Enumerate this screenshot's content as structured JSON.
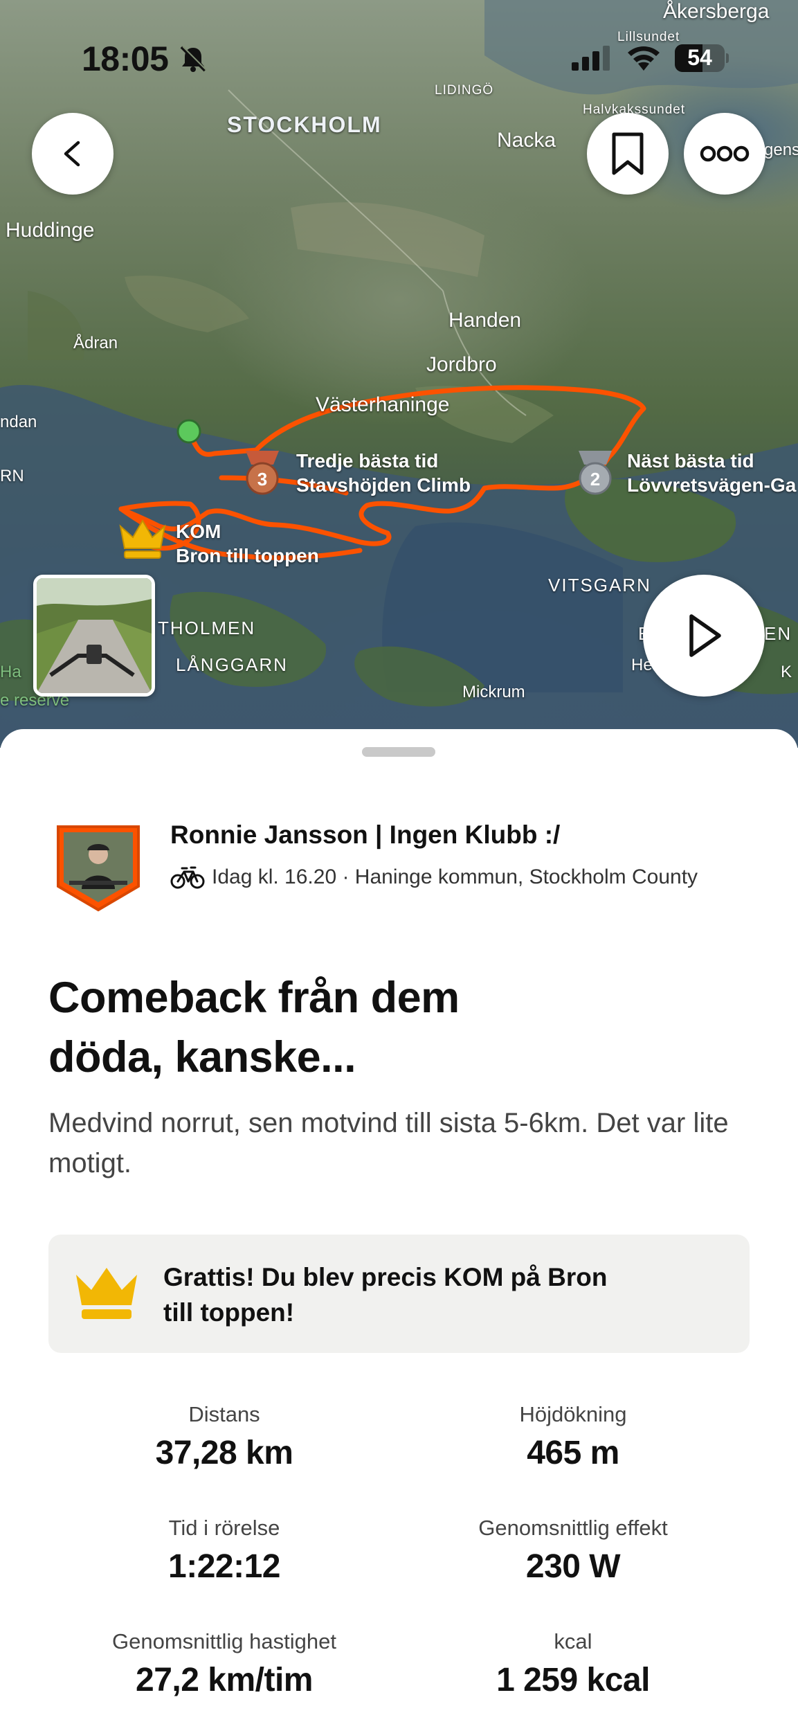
{
  "status_bar": {
    "time": "18:05",
    "battery": "54"
  },
  "map": {
    "labels": {
      "akersberga": "Åkersberga",
      "lillsundet": "Lillsundet",
      "lidingo": "LIDINGÖ",
      "stockholm": "STOCKHOLM",
      "nacka": "Nacka",
      "halvkakssundet": "Halvkakssundet",
      "gens": "gens",
      "huddinge": "Huddinge",
      "adran": "Ådran",
      "handen": "Handen",
      "jordbro": "Jordbro",
      "vasterhaninge": "Västerhaninge",
      "ndan": "ndan",
      "rn": "RN",
      "vitsgarn": "VITSGARN",
      "tholmen": "THOLMEN",
      "langgarn": "LÅNGGARN",
      "mickrum": "Mickrum",
      "ha": "Ha",
      "e_reserve": "e reserve",
      "en": "EN",
      "he": "He",
      "k": "K",
      "e": "E"
    },
    "segments": {
      "third": {
        "badge": "3",
        "line1": "Tredje bästa tid",
        "line2": "Stavshöjden Climb"
      },
      "second": {
        "badge": "2",
        "line1": "Näst bästa tid",
        "line2": "Lövvretsvägen-Ga"
      },
      "kom": {
        "line1": "KOM",
        "line2": "Bron till toppen"
      }
    },
    "colors": {
      "route": "#fc5200",
      "start": "#5cc95c",
      "kom": "#f2b705"
    }
  },
  "activity": {
    "athlete": "Ronnie Jansson | Ingen Klubb :/",
    "meta": "Idag kl. 16.20 · Haninge kommun, Stockholm County",
    "title": "Comeback från dem döda, kanske...",
    "description": "Medvind norrut, sen motvind till sista 5-6km. Det var lite motigt.",
    "achievement": "Grattis! Du blev precis KOM på Bron till toppen!",
    "stats": [
      {
        "label": "Distans",
        "value": "37,28 km"
      },
      {
        "label": "Höjdökning",
        "value": "465 m"
      },
      {
        "label": "Tid i rörelse",
        "value": "1:22:12"
      },
      {
        "label": "Genomsnittlig effekt",
        "value": "230 W"
      },
      {
        "label": "Genomsnittlig hastighet",
        "value": "27,2 km/tim"
      },
      {
        "label": "kcal",
        "value": "1 259 kcal"
      }
    ]
  }
}
